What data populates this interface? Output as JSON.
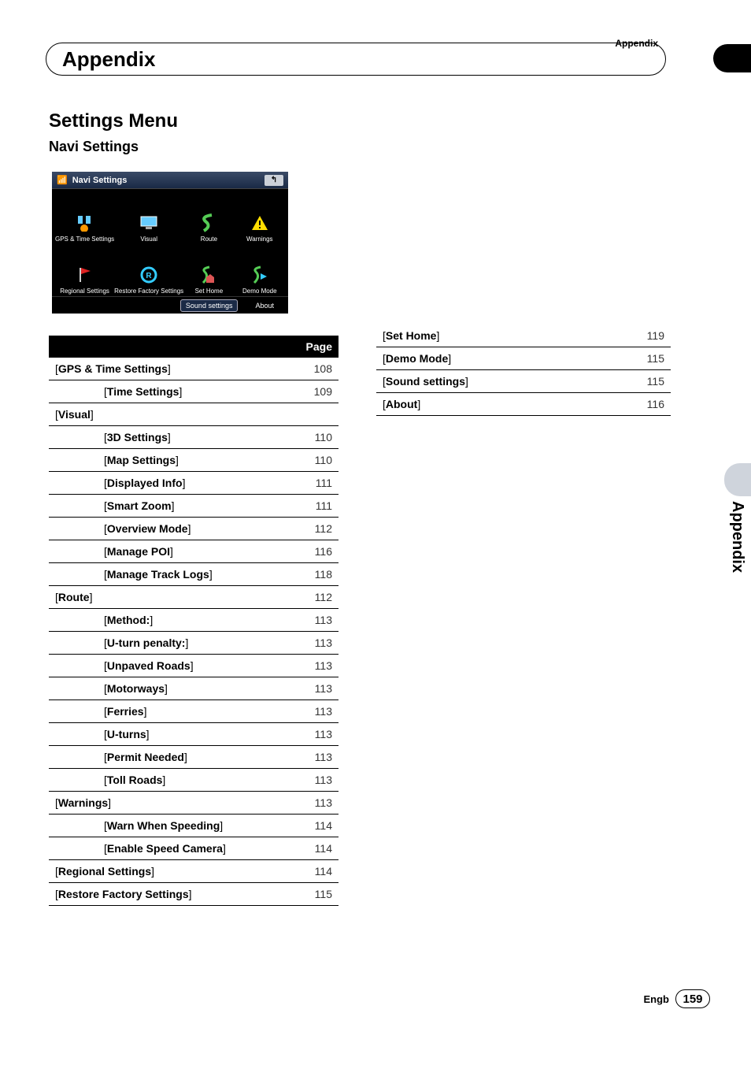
{
  "header": {
    "corner_label": "Appendix",
    "chapter_title": "Appendix"
  },
  "section": {
    "title": "Settings Menu",
    "subtitle": "Navi Settings"
  },
  "screenshot": {
    "title": "Navi Settings",
    "back": "↰",
    "items": [
      "GPS & Time Settings",
      "Visual",
      "Route",
      "Warnings",
      "Regional Settings",
      "Restore Factory Settings",
      "Set Home",
      "Demo Mode"
    ],
    "footer": {
      "left": "Sound settings",
      "right": "About"
    }
  },
  "table_header": {
    "col1": "",
    "col2": "Page"
  },
  "left_rows": [
    {
      "level": 0,
      "name": "GPS & Time Settings",
      "page": "108"
    },
    {
      "level": 1,
      "name": "Time Settings",
      "page": "109"
    },
    {
      "level": 0,
      "name": "Visual",
      "page": ""
    },
    {
      "level": 1,
      "name": "3D Settings",
      "page": "110"
    },
    {
      "level": 1,
      "name": "Map Settings",
      "page": "110"
    },
    {
      "level": 1,
      "name": "Displayed Info",
      "page": "111"
    },
    {
      "level": 1,
      "name": "Smart Zoom",
      "page": "111"
    },
    {
      "level": 1,
      "name": "Overview Mode",
      "page": "112"
    },
    {
      "level": 1,
      "name": "Manage POI",
      "page": "116"
    },
    {
      "level": 1,
      "name": "Manage Track Logs",
      "page": "118"
    },
    {
      "level": 0,
      "name": "Route",
      "page": "112"
    },
    {
      "level": 1,
      "name": "Method:",
      "page": "113"
    },
    {
      "level": 1,
      "name": "U-turn penalty:",
      "page": "113"
    },
    {
      "level": 1,
      "name": "Unpaved Roads",
      "page": "113"
    },
    {
      "level": 1,
      "name": "Motorways",
      "page": "113"
    },
    {
      "level": 1,
      "name": "Ferries",
      "page": "113"
    },
    {
      "level": 1,
      "name": "U-turns",
      "page": "113"
    },
    {
      "level": 1,
      "name": "Permit Needed",
      "page": "113"
    },
    {
      "level": 1,
      "name": "Toll Roads",
      "page": "113"
    },
    {
      "level": 0,
      "name": "Warnings",
      "page": "113"
    },
    {
      "level": 1,
      "name": "Warn When Speeding",
      "page": "114"
    },
    {
      "level": 1,
      "name": "Enable Speed Camera",
      "page": "114"
    },
    {
      "level": 0,
      "name": "Regional Settings",
      "page": "114"
    },
    {
      "level": 0,
      "name": "Restore Factory Settings",
      "page": "115"
    }
  ],
  "right_rows": [
    {
      "level": 0,
      "name": "Set Home",
      "page": "119"
    },
    {
      "level": 0,
      "name": "Demo Mode",
      "page": "115"
    },
    {
      "level": 0,
      "name": "Sound settings",
      "page": "115"
    },
    {
      "level": 0,
      "name": "About",
      "page": "116"
    }
  ],
  "side": {
    "label": "Appendix"
  },
  "footer": {
    "lang": "Engb",
    "page": "159"
  }
}
